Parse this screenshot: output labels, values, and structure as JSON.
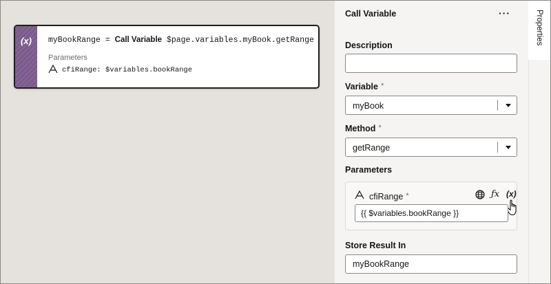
{
  "action": {
    "icon": "variable-icon",
    "icon_text": "(x)",
    "target": "myBookRange",
    "equals": "=",
    "keyword": "Call Variable",
    "method_path": "$page.variables.myBook.getRange",
    "params_label": "Parameters",
    "param_text": "cfiRange: $variables.bookRange"
  },
  "panel": {
    "title": "Call Variable",
    "more": "···",
    "description_label": "Description",
    "description_value": "",
    "variable_label": "Variable",
    "variable_required": "*",
    "variable_value": "myBook",
    "method_label": "Method",
    "method_required": "*",
    "method_value": "getRange",
    "parameters_label": "Parameters",
    "param": {
      "name": "cfiRange",
      "required": "*",
      "fx": "ƒx",
      "xvar": "(x)",
      "value": "{{ $variables.bookRange }}"
    },
    "store_label": "Store Result In",
    "store_value": "myBookRange"
  },
  "tabs": {
    "properties": "Properties"
  },
  "colors": {
    "canvas_bg": "#e5e2dd",
    "panel_bg": "#f5f4f2",
    "action_strip": "#7a5a8c"
  }
}
